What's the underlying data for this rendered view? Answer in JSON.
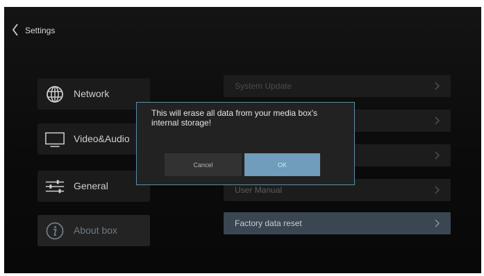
{
  "header": {
    "title": "Settings"
  },
  "menu": {
    "items": [
      {
        "label": "Network",
        "icon": "globe-icon"
      },
      {
        "label": "Video&Audio",
        "icon": "monitor-icon"
      },
      {
        "label": "General",
        "icon": "sliders-icon"
      },
      {
        "label": "About box",
        "icon": "info-icon"
      }
    ]
  },
  "list": {
    "items": [
      {
        "label": "System Update"
      },
      {
        "label": ""
      },
      {
        "label": ""
      },
      {
        "label": "User Manual"
      },
      {
        "label": "Factory data reset"
      }
    ]
  },
  "dialog": {
    "message": "This will erase all data from your media box's internal storage!",
    "cancel_label": "Cancel",
    "ok_label": "OK"
  },
  "colors": {
    "accent": "#6f9dbb",
    "dialog_border": "#5a8ea5",
    "selected_row": "#3a4652"
  }
}
